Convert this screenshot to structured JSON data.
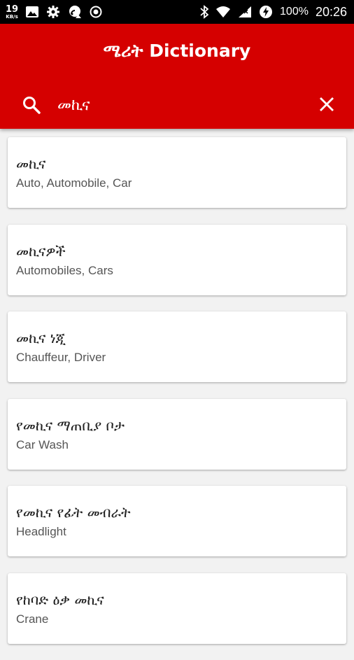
{
  "status_bar": {
    "net_speed": "19",
    "net_unit": "KB/s",
    "battery": "100%",
    "time": "20:26",
    "icons": [
      "image-icon",
      "settings-gear-icon",
      "cast-icon",
      "record-icon",
      "bluetooth-icon",
      "wifi-icon",
      "signal-icon",
      "data-saver-icon"
    ]
  },
  "app": {
    "title": "ሜሪት Dictionary",
    "brand_color": "#d50000"
  },
  "search": {
    "value": "መኪና"
  },
  "results": [
    {
      "term": "መኪና",
      "meaning": "Auto, Automobile, Car"
    },
    {
      "term": "መኪናዎች",
      "meaning": "Automobiles, Cars"
    },
    {
      "term": "መኪና ነጂ",
      "meaning": "Chauffeur, Driver"
    },
    {
      "term": "የመኪና ማጠቢያ ቦታ",
      "meaning": "Car Wash"
    },
    {
      "term": "የመኪና የፊት መብራት",
      "meaning": "Headlight"
    },
    {
      "term": "የከባድ ዕቃ መኪና",
      "meaning": "Crane"
    }
  ]
}
